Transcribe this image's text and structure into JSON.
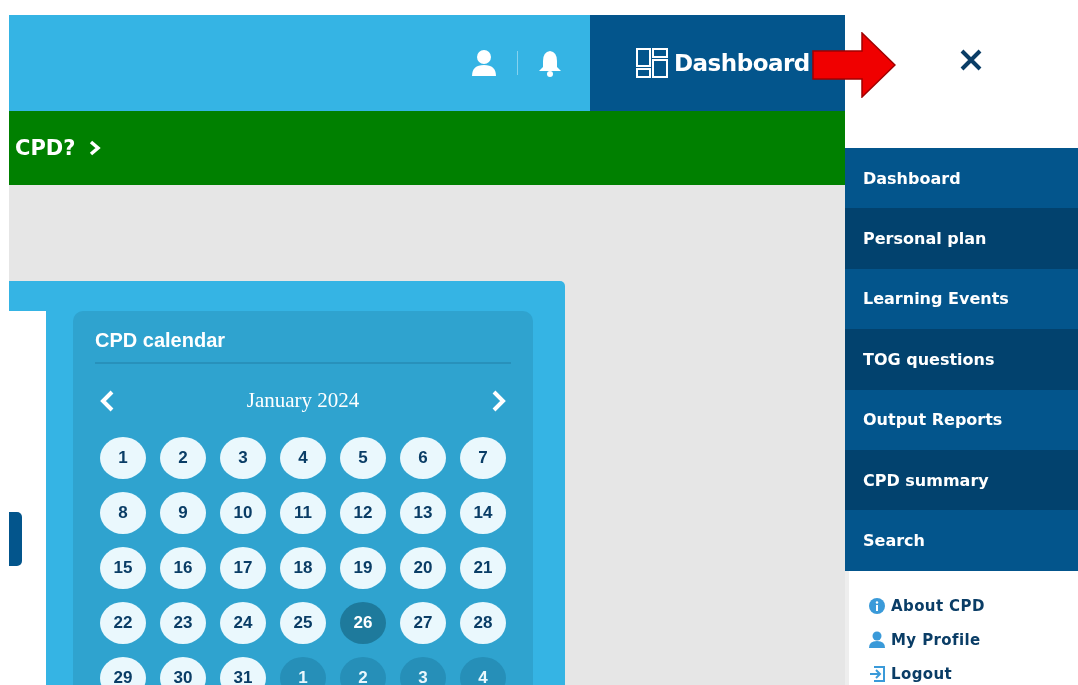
{
  "top_bar": {
    "dashboard_label": "Dashboard"
  },
  "banner": {
    "text": "CPD?"
  },
  "calendar": {
    "title": "CPD calendar",
    "month": "January 2024",
    "days": [
      {
        "label": "1",
        "in_month": true,
        "selected": false
      },
      {
        "label": "2",
        "in_month": true,
        "selected": false
      },
      {
        "label": "3",
        "in_month": true,
        "selected": false
      },
      {
        "label": "4",
        "in_month": true,
        "selected": false
      },
      {
        "label": "5",
        "in_month": true,
        "selected": false
      },
      {
        "label": "6",
        "in_month": true,
        "selected": false
      },
      {
        "label": "7",
        "in_month": true,
        "selected": false
      },
      {
        "label": "8",
        "in_month": true,
        "selected": false
      },
      {
        "label": "9",
        "in_month": true,
        "selected": false
      },
      {
        "label": "10",
        "in_month": true,
        "selected": false
      },
      {
        "label": "11",
        "in_month": true,
        "selected": false
      },
      {
        "label": "12",
        "in_month": true,
        "selected": false
      },
      {
        "label": "13",
        "in_month": true,
        "selected": false
      },
      {
        "label": "14",
        "in_month": true,
        "selected": false
      },
      {
        "label": "15",
        "in_month": true,
        "selected": false
      },
      {
        "label": "16",
        "in_month": true,
        "selected": false
      },
      {
        "label": "17",
        "in_month": true,
        "selected": false
      },
      {
        "label": "18",
        "in_month": true,
        "selected": false
      },
      {
        "label": "19",
        "in_month": true,
        "selected": false
      },
      {
        "label": "20",
        "in_month": true,
        "selected": false
      },
      {
        "label": "21",
        "in_month": true,
        "selected": false
      },
      {
        "label": "22",
        "in_month": true,
        "selected": false
      },
      {
        "label": "23",
        "in_month": true,
        "selected": false
      },
      {
        "label": "24",
        "in_month": true,
        "selected": false
      },
      {
        "label": "25",
        "in_month": true,
        "selected": false
      },
      {
        "label": "26",
        "in_month": true,
        "selected": true
      },
      {
        "label": "27",
        "in_month": true,
        "selected": false
      },
      {
        "label": "28",
        "in_month": true,
        "selected": false
      },
      {
        "label": "29",
        "in_month": true,
        "selected": false
      },
      {
        "label": "30",
        "in_month": true,
        "selected": false
      },
      {
        "label": "31",
        "in_month": true,
        "selected": false
      },
      {
        "label": "1",
        "in_month": false,
        "selected": false
      },
      {
        "label": "2",
        "in_month": false,
        "selected": false
      },
      {
        "label": "3",
        "in_month": false,
        "selected": false
      },
      {
        "label": "4",
        "in_month": false,
        "selected": false
      }
    ]
  },
  "menu": {
    "items": [
      "Dashboard",
      "Personal plan",
      "Learning Events",
      "TOG questions",
      "Output Reports",
      "CPD summary",
      "Search"
    ],
    "links": [
      {
        "kind": "info",
        "label": "About CPD"
      },
      {
        "kind": "profile",
        "label": "My Profile"
      },
      {
        "kind": "logout",
        "label": "Logout"
      }
    ]
  }
}
